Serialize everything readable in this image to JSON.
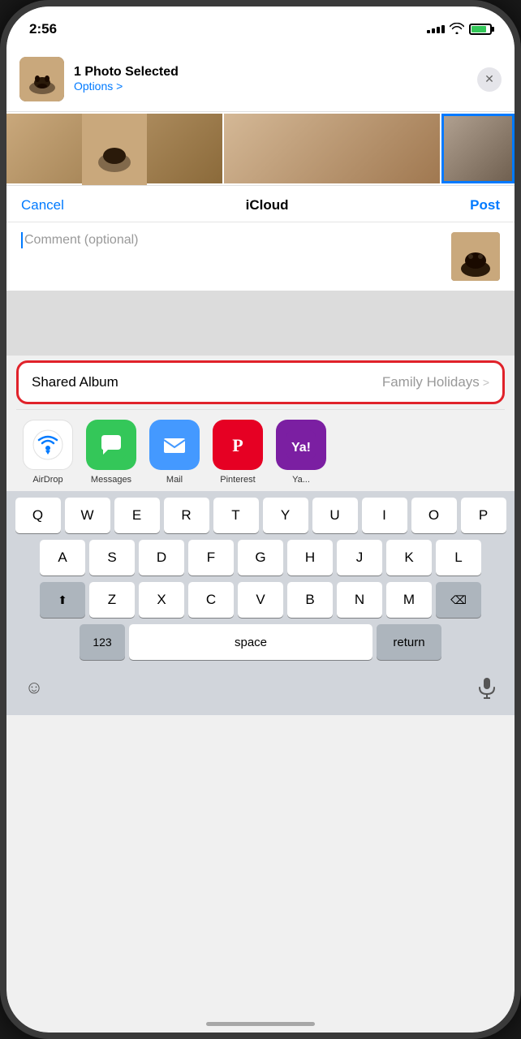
{
  "statusBar": {
    "time": "2:56",
    "signalBars": [
      3,
      5,
      7,
      9,
      11
    ],
    "batteryPercent": 80
  },
  "shareHeader": {
    "title": "1 Photo Selected",
    "optionsLabel": "Options >",
    "closeLabel": "×"
  },
  "icloudPanel": {
    "cancelLabel": "Cancel",
    "titleLabel": "iCloud",
    "postLabel": "Post",
    "commentPlaceholder": "Comment (optional)"
  },
  "sharedAlbumRow": {
    "label": "Shared Album",
    "value": "Family Holidays",
    "chevron": ">"
  },
  "shareApps": [
    {
      "name": "AirDrop",
      "type": "airdrop"
    },
    {
      "name": "Messages",
      "type": "messages"
    },
    {
      "name": "Mail",
      "type": "mail"
    },
    {
      "name": "Pinterest",
      "type": "pinterest"
    },
    {
      "name": "Ya...",
      "type": "yahoo"
    }
  ],
  "keyboard": {
    "rows": [
      [
        "Q",
        "W",
        "E",
        "R",
        "T",
        "Y",
        "U",
        "I",
        "O",
        "P"
      ],
      [
        "A",
        "S",
        "D",
        "F",
        "G",
        "H",
        "J",
        "K",
        "L"
      ],
      [
        "Z",
        "X",
        "C",
        "V",
        "B",
        "N",
        "M"
      ]
    ],
    "specialKeys": {
      "num": "123",
      "space": "space",
      "return": "return",
      "shift": "⬆",
      "backspace": "⌫"
    }
  }
}
